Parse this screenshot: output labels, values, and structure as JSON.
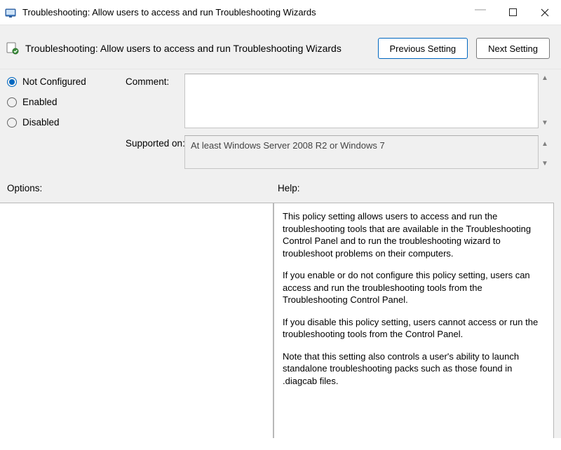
{
  "titlebar": {
    "title": "Troubleshooting: Allow users to access and run Troubleshooting Wizards"
  },
  "header": {
    "policy_title": "Troubleshooting: Allow users to access and run Troubleshooting Wizards",
    "prev_label": "Previous Setting",
    "next_label": "Next Setting"
  },
  "state": {
    "not_configured": "Not Configured",
    "enabled": "Enabled",
    "disabled": "Disabled",
    "selected": "not_configured"
  },
  "comment": {
    "label": "Comment:",
    "value": ""
  },
  "supported": {
    "label": "Supported on:",
    "value": "At least Windows Server 2008 R2 or Windows 7"
  },
  "lower": {
    "options_label": "Options:",
    "help_label": "Help:",
    "help_p1": "This policy setting allows users to access and run the troubleshooting tools that are available in the Troubleshooting Control Panel and to run the troubleshooting wizard to troubleshoot problems on their computers.",
    "help_p2": "If you enable or do not configure this policy setting, users can access and run the troubleshooting tools from the Troubleshooting Control Panel.",
    "help_p3": "If you disable this policy setting, users cannot access or run the troubleshooting tools from the Control Panel.",
    "help_p4": "Note that this setting also controls a user's ability to launch standalone troubleshooting packs such as those found in .diagcab files."
  }
}
